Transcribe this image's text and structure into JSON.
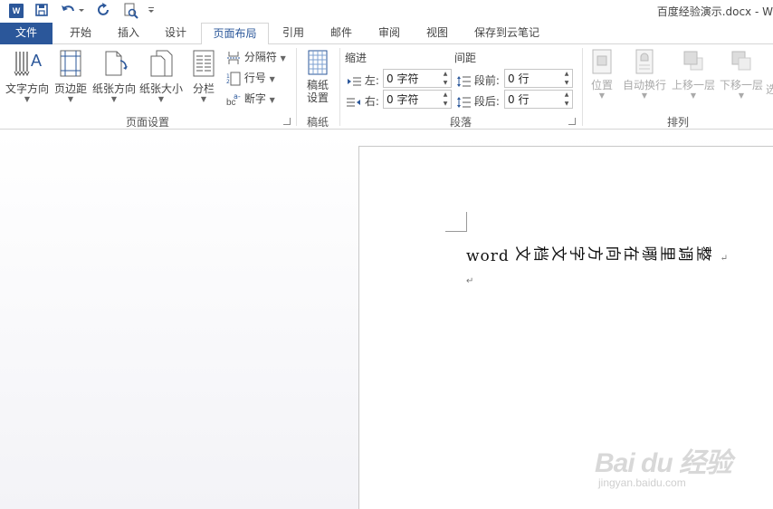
{
  "window": {
    "title": "百度经验演示.docx - W"
  },
  "tabs": [
    {
      "label": "文件"
    },
    {
      "label": "开始"
    },
    {
      "label": "插入"
    },
    {
      "label": "设计"
    },
    {
      "label": "页面布局"
    },
    {
      "label": "引用"
    },
    {
      "label": "邮件"
    },
    {
      "label": "审阅"
    },
    {
      "label": "视图"
    },
    {
      "label": "保存到云笔记"
    }
  ],
  "ribbon": {
    "page_setup": {
      "label": "页面设置",
      "text_direction": "文字方向",
      "margins": "页边距",
      "orientation": "纸张方向",
      "size": "纸张大小",
      "columns": "分栏",
      "breaks": "分隔符",
      "line_numbers": "行号",
      "hyphenation": "断字"
    },
    "manuscript": {
      "label": "稿纸",
      "settings_line1": "稿纸",
      "settings_line2": "设置"
    },
    "paragraph": {
      "label": "段落",
      "indent_title": "缩进",
      "spacing_title": "间距",
      "left_label": "左:",
      "right_label": "右:",
      "before_label": "段前:",
      "after_label": "段后:",
      "left_value": "0 字符",
      "right_value": "0 字符",
      "before_value": "0 行",
      "after_value": "0 行"
    },
    "arrange": {
      "label": "排列",
      "position": "位置",
      "wrap_text": "自动换行",
      "bring_forward": "上移一层",
      "send_backward": "下移一层",
      "selection_pane": "选"
    }
  },
  "document": {
    "line_prefix": "word",
    "vertical_chars": [
      "文",
      "档",
      "文",
      "字",
      "方",
      "向",
      "在",
      "哪",
      "里",
      "调",
      "整"
    ],
    "para_mark": "↵"
  },
  "watermark": {
    "brand": "Bai du 经验",
    "url": "jingyan.baidu.com"
  },
  "colors": {
    "accent": "#2b579a"
  }
}
